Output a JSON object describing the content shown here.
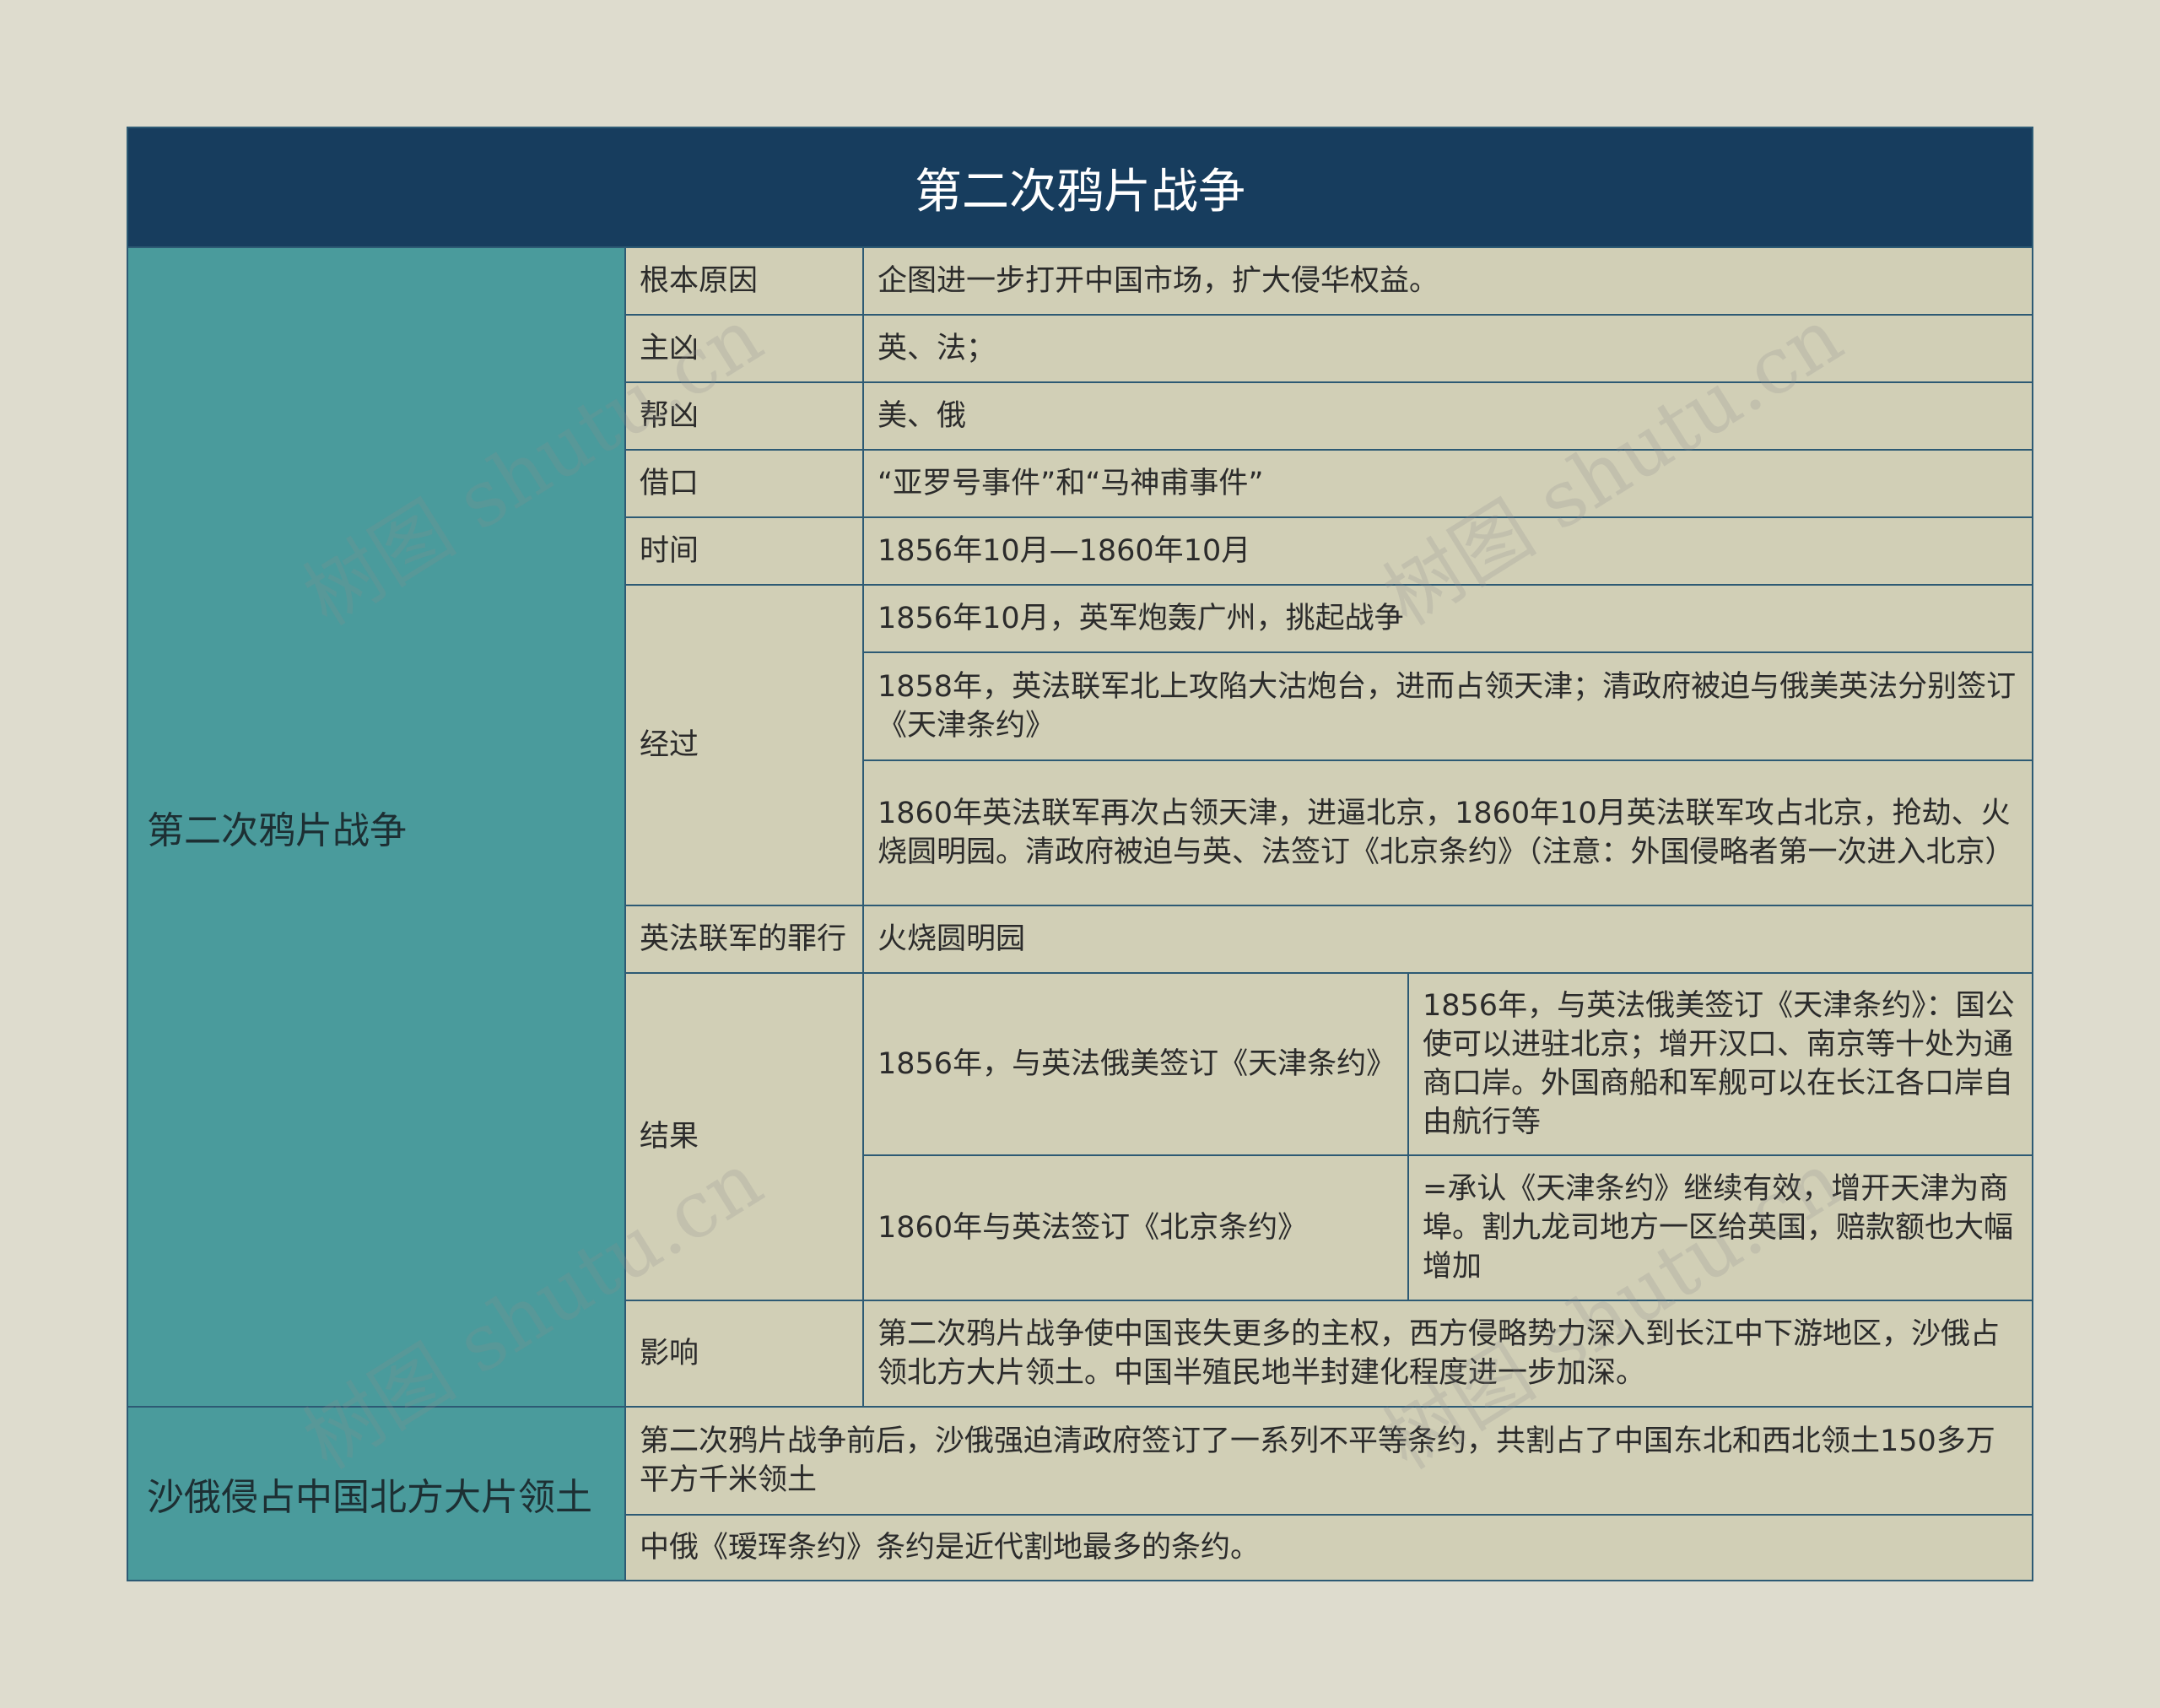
{
  "title": "第二次鸦片战争",
  "sections": [
    {
      "name": "第二次鸦片战争",
      "rows": [
        {
          "label": "根本原因",
          "content": "企图进一步打开中国市场，扩大侵华权益。"
        },
        {
          "label": "主凶",
          "content": "英、法；"
        },
        {
          "label": "帮凶",
          "content": "美、俄"
        },
        {
          "label": "借口",
          "content": "“亚罗号事件”和“马神甫事件”"
        },
        {
          "label": "时间",
          "content": "1856年10月—1860年10月"
        },
        {
          "label": "经过",
          "items": [
            "1856年10月，英军炮轰广州，挑起战争",
            "1858年，英法联军北上攻陷大沽炮台，进而占领天津；清政府被迫与俄美英法分别签订《天津条约》",
            "1860年英法联军再次占领天津，进逼北京，1860年10月英法联军攻占北京，抢劫、火烧圆明园。清政府被迫与英、法签订《北京条约》（注意：外国侵略者第一次进入北京）"
          ]
        },
        {
          "label": "英法联军的罪行",
          "content": "火烧圆明园"
        },
        {
          "label": "结果",
          "pairs": [
            {
              "key": "1856年，与英法俄美签订《天津条约》",
              "detail": "1856年，与英法俄美签订《天津条约》：国公使可以进驻北京；增开汉口、南京等十处为通商口岸。外国商船和军舰可以在长江各口岸自由航行等"
            },
            {
              "key": "1860年与英法签订《北京条约》",
              "detail": "=承认《天津条约》继续有效，增开天津为商埠。割九龙司地方一区给英国，赔款额也大幅增加"
            }
          ]
        },
        {
          "label": "影响",
          "content": "第二次鸦片战争使中国丧失更多的主权，西方侵略势力深入到长江中下游地区，沙俄占领北方大片领土。中国半殖民地半封建化程度进一步加深。"
        }
      ]
    },
    {
      "name": "沙俄侵占中国北方大片领土",
      "items": [
        "第二次鸦片战争前后，沙俄强迫清政府签订了一系列不平等条约，共割占了中国东北和西北领土150多万平方千米领土",
        "中俄《瑷珲条约》条约是近代割地最多的条约。"
      ]
    }
  ],
  "watermark": "树图 shutu.cn",
  "colors": {
    "background": "#dedcce",
    "title_bar": "#173d5e",
    "left_cell": "#4a9b9c",
    "cell": "#d1cfb6",
    "border": "#2d5a74"
  }
}
